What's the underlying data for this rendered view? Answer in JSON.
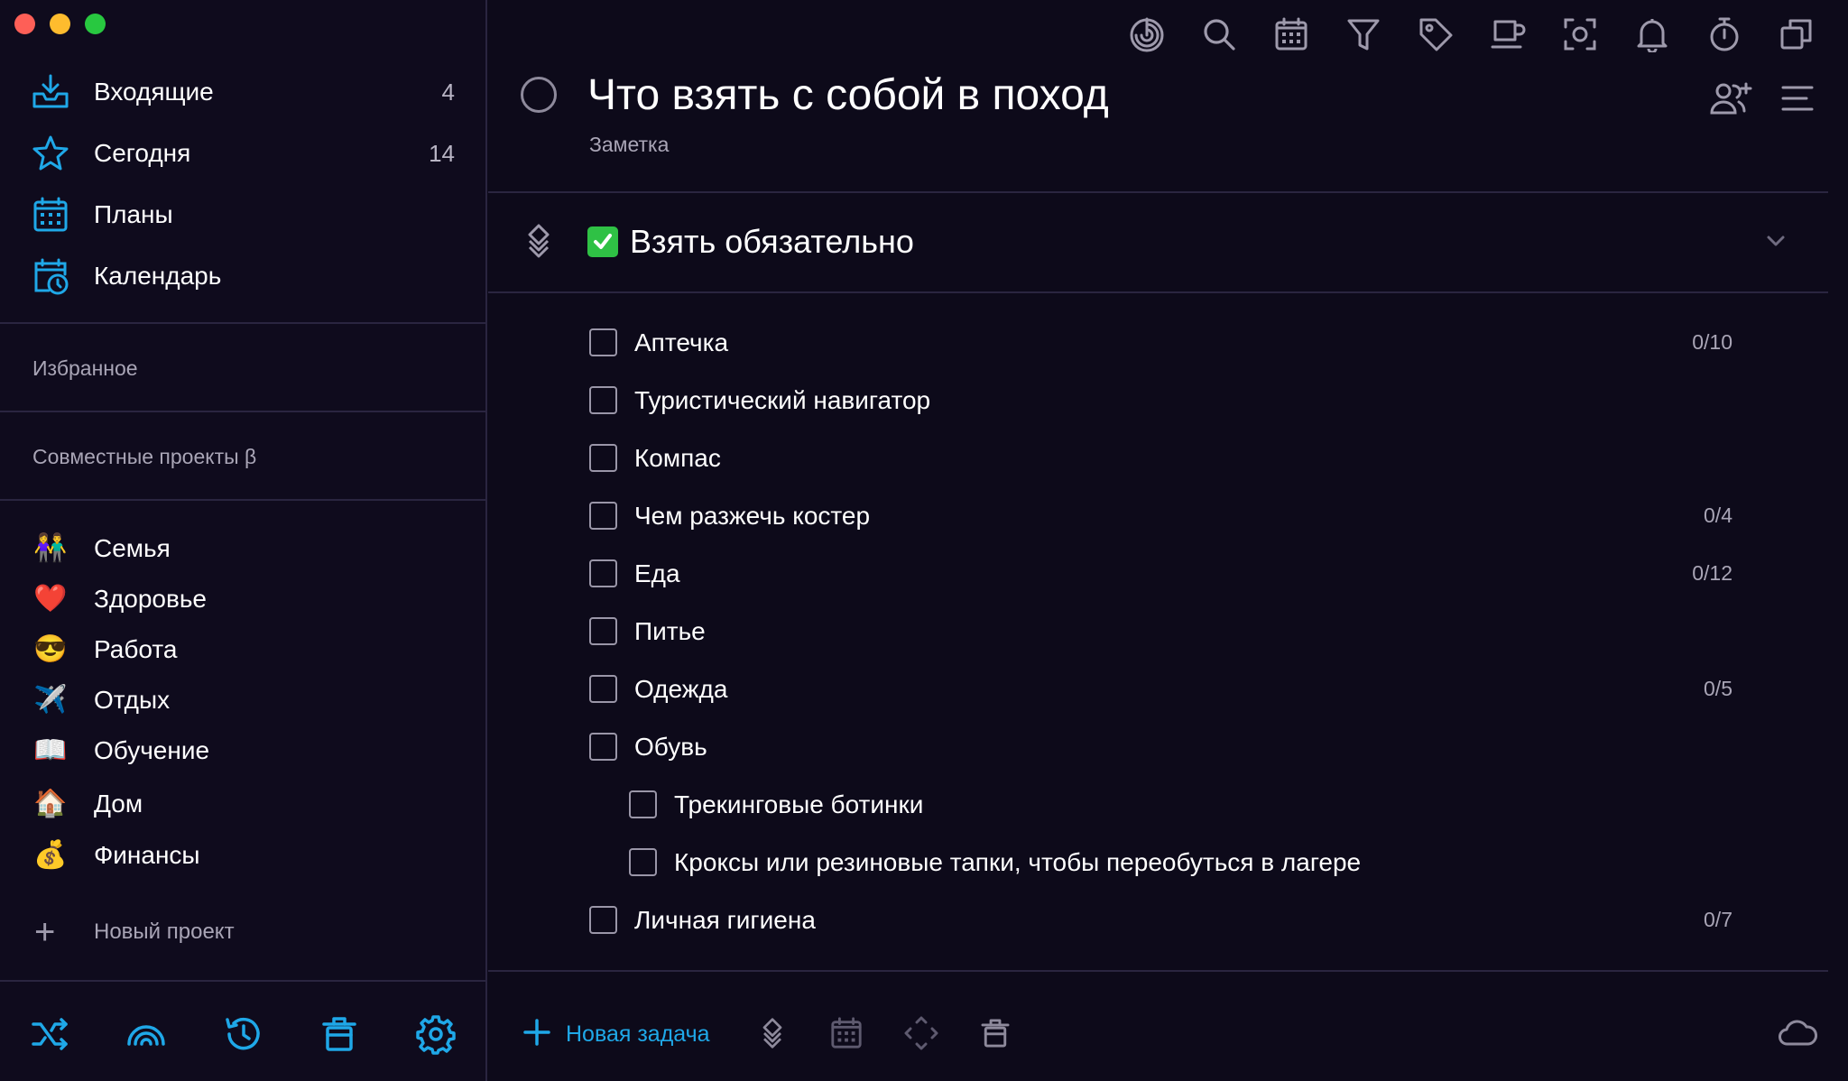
{
  "colors": {
    "background": "#0d0a1a",
    "sidebar": "#0f0b1d",
    "accent": "#1fa8e8",
    "muted_text": "#a9a5b6",
    "checkbox_green": "#2fc145"
  },
  "window": {
    "controls": [
      "close",
      "minimize",
      "zoom"
    ]
  },
  "sidebar": {
    "nav": [
      {
        "label": "Входящие",
        "count": "4",
        "icon": "inbox-icon"
      },
      {
        "label": "Сегодня",
        "count": "14",
        "icon": "star-icon"
      },
      {
        "label": "Планы",
        "count": "",
        "icon": "calendar-grid-icon"
      },
      {
        "label": "Календарь",
        "count": "",
        "icon": "calendar-clock-icon"
      }
    ],
    "favorites_label": "Избранное",
    "shared_label": "Совместные проекты β",
    "projects": [
      {
        "emoji": "👫",
        "label": "Семья"
      },
      {
        "emoji": "❤️",
        "label": "Здоровье"
      },
      {
        "emoji": "😎",
        "label": "Работа"
      },
      {
        "emoji": "✈️",
        "label": "Отдых"
      },
      {
        "emoji": "📖",
        "label": "Обучение"
      },
      {
        "emoji": "🏠",
        "label": "Дом"
      },
      {
        "emoji": "💰",
        "label": "Финансы"
      }
    ],
    "new_project_label": "Новый проект",
    "tools": [
      "shuffle-icon",
      "rainbow-icon",
      "history-icon",
      "trash-icon",
      "settings-icon"
    ]
  },
  "toolbar": {
    "icons": [
      "focus-icon",
      "search-icon",
      "calendar-icon",
      "filter-icon",
      "tag-icon",
      "coffee-icon",
      "screenshot-icon",
      "bell-icon",
      "timer-icon",
      "copy-icon"
    ]
  },
  "note": {
    "title": "Что взять с собой в поход",
    "subtitle": "Заметка"
  },
  "section": {
    "title": "Взять обязательно"
  },
  "tasks": [
    {
      "label": "Аптечка",
      "count": "0/10",
      "indent": 0
    },
    {
      "label": "Туристический навигатор",
      "count": "",
      "indent": 0
    },
    {
      "label": "Компас",
      "count": "",
      "indent": 0
    },
    {
      "label": "Чем разжечь костер",
      "count": "0/4",
      "indent": 0
    },
    {
      "label": "Еда",
      "count": "0/12",
      "indent": 0
    },
    {
      "label": "Питье",
      "count": "",
      "indent": 0
    },
    {
      "label": "Одежда",
      "count": "0/5",
      "indent": 0
    },
    {
      "label": "Обувь",
      "count": "",
      "indent": 0
    },
    {
      "label": "Трекинговые ботинки",
      "count": "",
      "indent": 1
    },
    {
      "label": "Кроксы или резиновые тапки, чтобы переобуться в лагере",
      "count": "",
      "indent": 1
    },
    {
      "label": "Личная гигиена",
      "count": "0/7",
      "indent": 0
    }
  ],
  "bottom_bar": {
    "new_task_label": "Новая задача",
    "tools": [
      "section-icon",
      "calendar-icon",
      "move-icon",
      "trash-icon"
    ],
    "sync_icon": "cloud-icon"
  }
}
